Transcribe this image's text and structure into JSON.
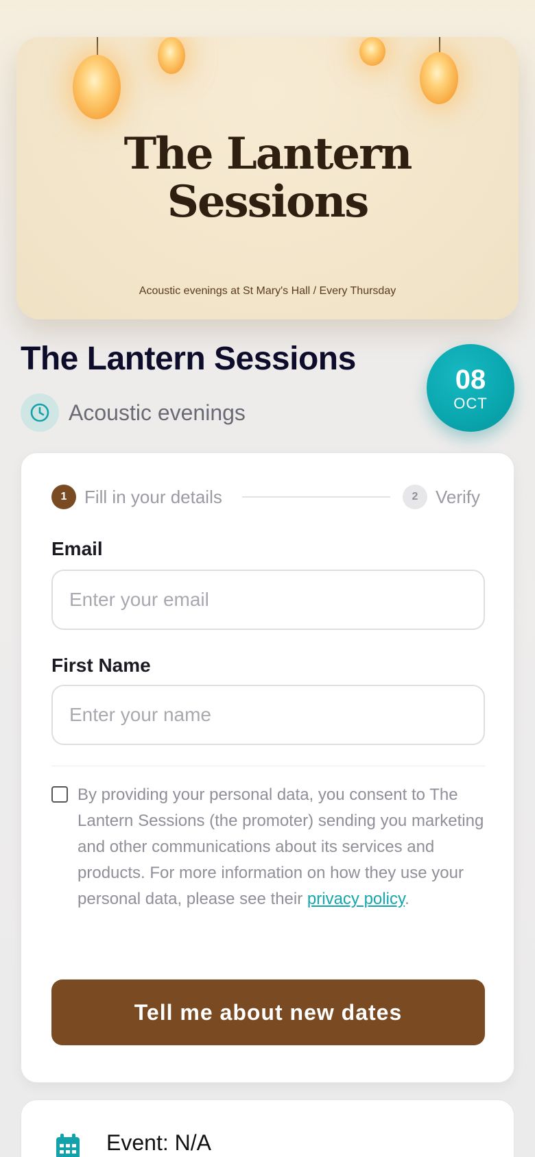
{
  "hero": {
    "title_line1": "The Lantern",
    "title_line2": "Sessions",
    "tagline": "Acoustic evenings at St Mary's Hall / Every Thursday"
  },
  "event": {
    "title": "The Lantern Sessions",
    "subtitle": "Acoustic evenings",
    "date_day": "08",
    "date_month": "OCT"
  },
  "stepper": {
    "step1_number": "1",
    "step1_label": "Fill in your details",
    "step2_number": "2",
    "step2_label": "Verify"
  },
  "form": {
    "email_label": "Email",
    "email_placeholder": "Enter your email",
    "email_value": "",
    "name_label": "First Name",
    "name_placeholder": "Enter your name",
    "name_value": "",
    "consent_checked": false,
    "consent_text": "By providing your personal data, you consent to The Lantern Sessions (the promoter) sending you marketing and other communications about its services and products. For more information on how they use your personal data, please see their ",
    "privacy_link": "privacy policy",
    "consent_end": ".",
    "submit_label": "Tell me about new dates"
  },
  "event_card": {
    "event_text": "Event: N/A"
  },
  "colors": {
    "accent_teal": "#0aa6ae",
    "brand_brown": "#7a4a22",
    "title_navy": "#0d0d2b",
    "link_teal": "#13a6af"
  },
  "icons": {
    "subtitle_icon": "clock-icon",
    "event_icon": "calendar-icon"
  }
}
